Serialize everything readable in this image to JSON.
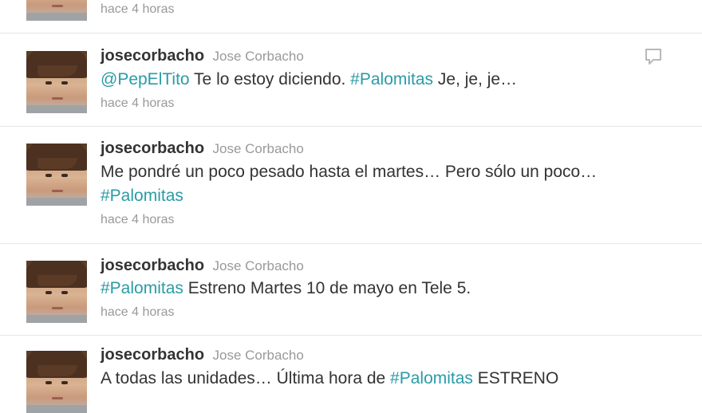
{
  "tweets": [
    {
      "screen_name": "",
      "full_name": "",
      "parts": [],
      "time": "hace 4 horas"
    },
    {
      "screen_name": "josecorbacho",
      "full_name": "Jose Corbacho",
      "parts": [
        {
          "t": "@PepElTito",
          "link": true
        },
        {
          "t": " Te lo estoy diciendo. ",
          "link": false
        },
        {
          "t": "#Palomitas",
          "link": true
        },
        {
          "t": " Je, je, je…",
          "link": false
        }
      ],
      "time": "hace 4 horas"
    },
    {
      "screen_name": "josecorbacho",
      "full_name": "Jose Corbacho",
      "parts": [
        {
          "t": "Me pondré un poco pesado hasta el martes… Pero sólo un poco… ",
          "link": false
        },
        {
          "t": "#Palomitas",
          "link": true
        }
      ],
      "time": "hace 4 horas"
    },
    {
      "screen_name": "josecorbacho",
      "full_name": "Jose Corbacho",
      "parts": [
        {
          "t": "#Palomitas",
          "link": true
        },
        {
          "t": " Estreno Martes 10 de mayo en Tele 5.",
          "link": false
        }
      ],
      "time": "hace 4 horas"
    },
    {
      "screen_name": "josecorbacho",
      "full_name": "Jose Corbacho",
      "parts": [
        {
          "t": "A todas las unidades… Última hora de ",
          "link": false
        },
        {
          "t": "#Palomitas",
          "link": true
        },
        {
          "t": " ESTRENO",
          "link": false
        }
      ],
      "time": ""
    }
  ],
  "icons": {
    "reply": "reply-icon",
    "avatar": "avatar"
  },
  "colors": {
    "link": "#2a9ba6",
    "meta": "#999999",
    "text": "#333333",
    "divider": "#e6e6e6"
  }
}
